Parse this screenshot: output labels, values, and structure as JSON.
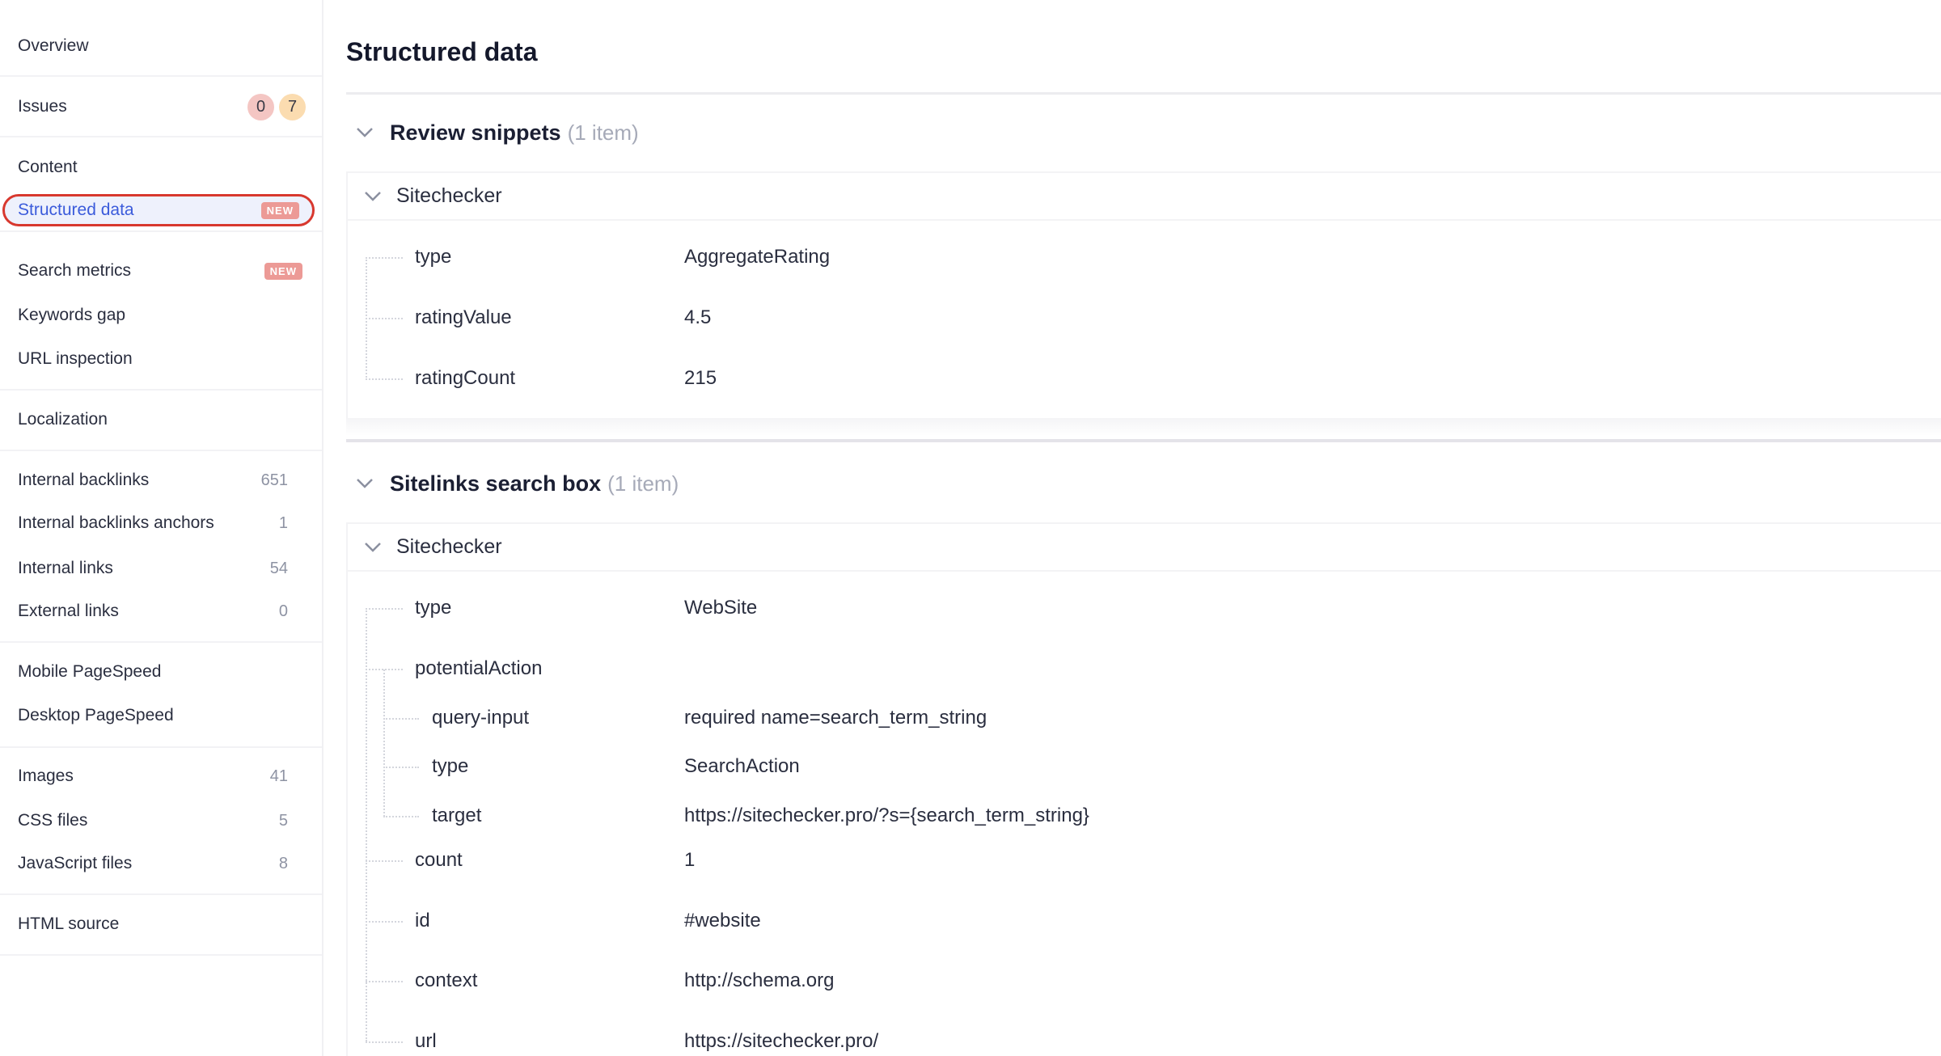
{
  "sidebar": {
    "items": [
      {
        "label": "Overview"
      },
      {
        "label": "Issues",
        "errors": "0",
        "warnings": "7"
      },
      {
        "label": "Content"
      },
      {
        "label": "Structured data",
        "badge": "NEW"
      },
      {
        "label": "Search metrics",
        "badge": "NEW"
      },
      {
        "label": "Keywords gap"
      },
      {
        "label": "URL inspection"
      },
      {
        "label": "Localization"
      },
      {
        "label": "Internal backlinks",
        "count": "651"
      },
      {
        "label": "Internal backlinks anchors",
        "count": "1"
      },
      {
        "label": "Internal links",
        "count": "54"
      },
      {
        "label": "External links",
        "count": "0"
      },
      {
        "label": "Mobile PageSpeed"
      },
      {
        "label": "Desktop PageSpeed"
      },
      {
        "label": "Images",
        "count": "41"
      },
      {
        "label": "CSS files",
        "count": "5"
      },
      {
        "label": "JavaScript files",
        "count": "8"
      },
      {
        "label": "HTML source"
      }
    ],
    "active_item": "Structured data",
    "colors": {
      "active_text": "#3b5bdb",
      "highlight_ring": "#d8382e",
      "new_badge": "#ec9a96",
      "errors_pill": "#f4c6c3",
      "warnings_pill": "#fbdcb0"
    }
  },
  "main": {
    "title": "Structured data",
    "sections": [
      {
        "name": "Review snippets",
        "meta": "(1 item)",
        "card": {
          "name": "Sitechecker",
          "rows": [
            {
              "key": "type",
              "value": "AggregateRating"
            },
            {
              "key": "ratingValue",
              "value": "4.5"
            },
            {
              "key": "ratingCount",
              "value": "215"
            }
          ]
        }
      },
      {
        "name": "Sitelinks search box",
        "meta": "(1 item)",
        "card": {
          "name": "Sitechecker",
          "rows": [
            {
              "key": "type",
              "value": "WebSite"
            },
            {
              "key": "potentialAction",
              "value": ""
            },
            {
              "key": "query-input",
              "value": "required name=search_term_string"
            },
            {
              "key": "type",
              "value": "SearchAction"
            },
            {
              "key": "target",
              "value": "https://sitechecker.pro/?s={search_term_string}"
            },
            {
              "key": "count",
              "value": "1"
            },
            {
              "key": "id",
              "value": "#website"
            },
            {
              "key": "context",
              "value": "http://schema.org"
            },
            {
              "key": "url",
              "value": "https://sitechecker.pro/"
            }
          ]
        }
      }
    ]
  },
  "icons": {
    "section_toggle": "chevron-down-icon",
    "card_toggle": "chevron-down-icon"
  }
}
